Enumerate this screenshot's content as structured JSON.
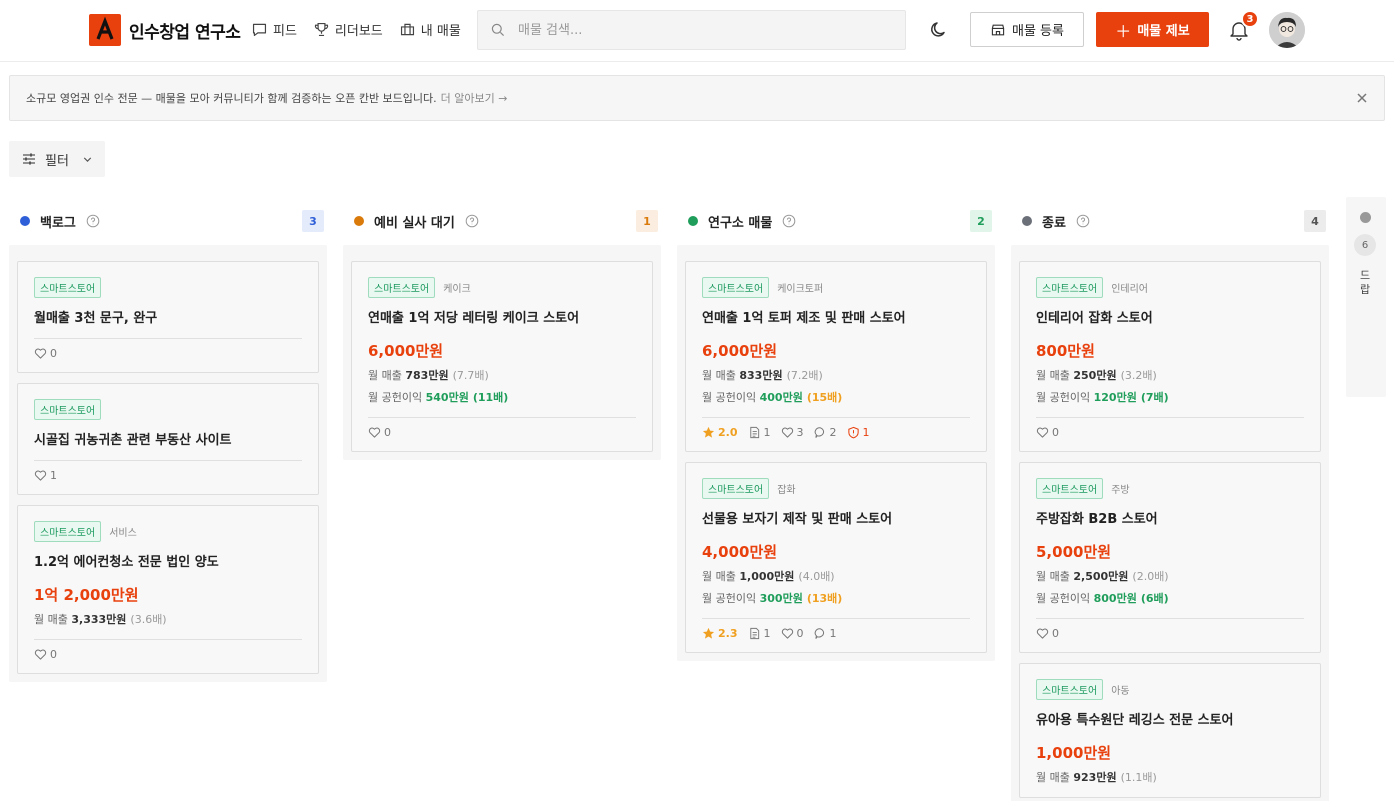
{
  "header": {
    "logo_text": "인수창업 연구소",
    "nav": [
      {
        "label": "피드"
      },
      {
        "label": "리더보드"
      },
      {
        "label": "내 매물"
      }
    ],
    "search_placeholder": "매물 검색...",
    "register_label": "매물 등록",
    "report_label": "매물 제보",
    "notification_count": "3",
    "colors": {
      "accent": "#e8410e"
    }
  },
  "banner": {
    "text": "소규모 영업권 인수 전문 — 매물을 모아 커뮤니티가 함께 검증하는 오픈 칸반 보드입니다.",
    "more": "더 알아보기 →"
  },
  "filter": {
    "label": "필터"
  },
  "columns": [
    {
      "title": "백로그",
      "count": "3",
      "color": "#2f5fd8",
      "count_bg": "#e4ebfb",
      "count_color": "#2f5fd8",
      "cards": [
        {
          "tag": "스마트스토어",
          "title": "월매출 3천 문구, 완구",
          "likes": "0"
        },
        {
          "tag": "스마트스토어",
          "title": "시골집 귀농귀촌 관련 부동산 사이트",
          "likes": "1"
        },
        {
          "tag": "스마트스토어",
          "subtag": "서비스",
          "title": "1.2억 에어컨청소 전문 법인 양도",
          "price": "1억 2,000만원",
          "rev_label": "월 매출",
          "rev_value": "3,333만원",
          "rev_mul": "(3.6배)",
          "likes": "0"
        }
      ]
    },
    {
      "title": "예비 실사 대기",
      "count": "1",
      "color": "#d97a0a",
      "count_bg": "#fbeee0",
      "count_color": "#d97a0a",
      "cards": [
        {
          "tag": "스마트스토어",
          "subtag": "케이크",
          "title": "연매출 1억 저당 레터링 케이크 스토어",
          "price": "6,000만원",
          "rev_label": "월 매출",
          "rev_value": "783만원",
          "rev_mul": "(7.7배)",
          "profit_label": "월 공헌이익",
          "profit_value": "540만원",
          "profit_mul": "(11배)",
          "likes": "0"
        }
      ]
    },
    {
      "title": "연구소 매물",
      "count": "2",
      "color": "#1f9d5a",
      "count_bg": "#e1f5ea",
      "count_color": "#1f9d5a",
      "cards": [
        {
          "tag": "스마트스토어",
          "subtag": "케이크토퍼",
          "title": "연매출 1억 토퍼 제조 및 판매 스토어",
          "price": "6,000만원",
          "rev_label": "월 매출",
          "rev_value": "833만원",
          "rev_mul": "(7.2배)",
          "profit_label": "월 공헌이익",
          "profit_value": "400만원",
          "profit_mul": "(15배)",
          "rating": "2.0",
          "docs": "1",
          "likes": "3",
          "comments": "2",
          "warnings": "1"
        },
        {
          "tag": "스마트스토어",
          "subtag": "잡화",
          "title": "선물용 보자기 제작 및 판매 스토어",
          "price": "4,000만원",
          "rev_label": "월 매출",
          "rev_value": "1,000만원",
          "rev_mul": "(4.0배)",
          "profit_label": "월 공헌이익",
          "profit_value": "300만원",
          "profit_mul": "(13배)",
          "rating": "2.3",
          "docs": "1",
          "likes": "0",
          "comments": "1"
        }
      ]
    },
    {
      "title": "종료",
      "count": "4",
      "color": "#6b6f78",
      "count_bg": "#ececec",
      "count_color": "#555555",
      "cards": [
        {
          "tag": "스마트스토어",
          "subtag": "인테리어",
          "title": "인테리어 잡화 스토어",
          "price": "800만원",
          "rev_label": "월 매출",
          "rev_value": "250만원",
          "rev_mul": "(3.2배)",
          "profit_label": "월 공헌이익",
          "profit_value": "120만원",
          "profit_mul": "(7배)",
          "likes": "0"
        },
        {
          "tag": "스마트스토어",
          "subtag": "주방",
          "title": "주방잡화 B2B 스토어",
          "price": "5,000만원",
          "rev_label": "월 매출",
          "rev_value": "2,500만원",
          "rev_mul": "(2.0배)",
          "profit_label": "월 공헌이익",
          "profit_value": "800만원",
          "profit_mul": "(6배)",
          "likes": "0"
        },
        {
          "tag": "스마트스토어",
          "subtag": "아동",
          "title": "유아용 특수원단 레깅스 전문 스토어",
          "price": "1,000만원",
          "rev_label": "월 매출",
          "rev_value": "923만원",
          "rev_mul": "(1.1배)"
        }
      ]
    }
  ],
  "side_column": {
    "count": "6",
    "label": "드랍"
  }
}
